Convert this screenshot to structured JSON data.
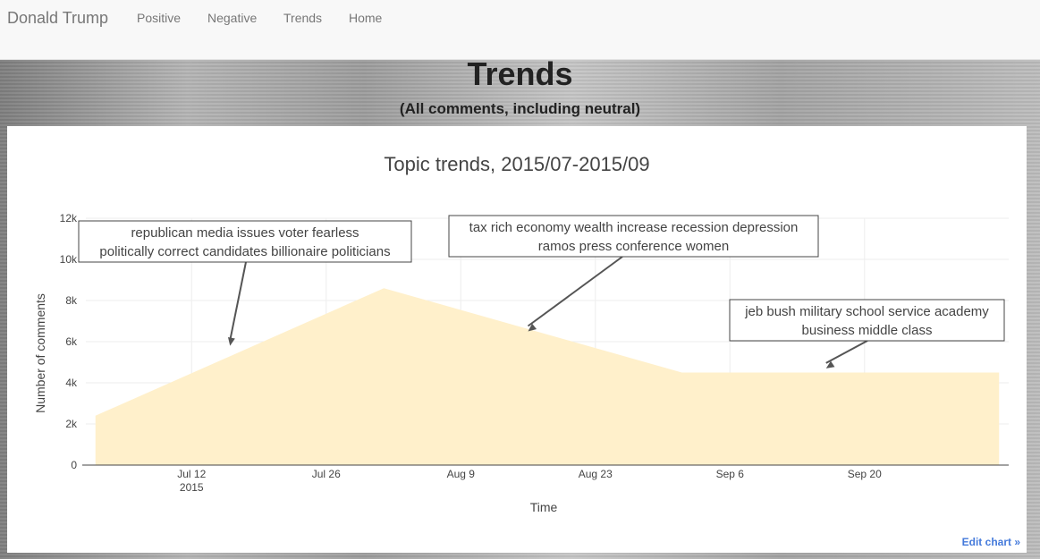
{
  "nav": {
    "brand": "Donald Trump",
    "links": [
      "Positive",
      "Negative",
      "Trends",
      "Home"
    ]
  },
  "header": {
    "title": "Trends",
    "subtitle": "(All comments, including neutral)"
  },
  "edit_chart_label": "Edit chart »",
  "colors": {
    "area_fill": "#fff0cb",
    "grid": "#eeeeee",
    "axis": "#444444",
    "edit_link": "#447adb"
  },
  "chart_data": {
    "type": "area",
    "title": "Topic trends, 2015/07-2015/09",
    "xlabel": "Time",
    "ylabel": "Number of comments",
    "ylim": [
      0,
      12000
    ],
    "y_ticks": [
      {
        "value": 0,
        "label": "0"
      },
      {
        "value": 2000,
        "label": "2k"
      },
      {
        "value": 4000,
        "label": "4k"
      },
      {
        "value": 6000,
        "label": "6k"
      },
      {
        "value": 8000,
        "label": "8k"
      },
      {
        "value": 10000,
        "label": "10k"
      },
      {
        "value": 12000,
        "label": "12k"
      }
    ],
    "xlim": [
      "2015-07-01",
      "2015-10-05"
    ],
    "x_ticks": [
      {
        "date": "2015-07-12",
        "label": "Jul 12",
        "sublabel": "2015"
      },
      {
        "date": "2015-07-26",
        "label": "Jul 26",
        "sublabel": ""
      },
      {
        "date": "2015-08-09",
        "label": "Aug 9",
        "sublabel": ""
      },
      {
        "date": "2015-08-23",
        "label": "Aug 23",
        "sublabel": ""
      },
      {
        "date": "2015-09-06",
        "label": "Sep 6",
        "sublabel": ""
      },
      {
        "date": "2015-09-20",
        "label": "Sep 20",
        "sublabel": ""
      }
    ],
    "grid": true,
    "series": [
      {
        "points": [
          {
            "x": "2015-07-02",
            "y": 2400
          },
          {
            "x": "2015-08-01",
            "y": 8600
          },
          {
            "x": "2015-09-01",
            "y": 4500
          },
          {
            "x": "2015-10-04",
            "y": 4500
          }
        ]
      }
    ],
    "annotations": [
      {
        "text_lines": [
          "republican media issues voter fearless",
          "politically correct candidates billionaire politicians"
        ],
        "x": "2015-07-16",
        "y": 5800
      },
      {
        "text_lines": [
          "tax rich economy wealth increase recession depression",
          "ramos press conference women"
        ],
        "x": "2015-08-16",
        "y": 6500
      },
      {
        "text_lines": [
          "jeb bush military school service academy",
          "business middle class"
        ],
        "x": "2015-09-16",
        "y": 4700
      }
    ]
  }
}
